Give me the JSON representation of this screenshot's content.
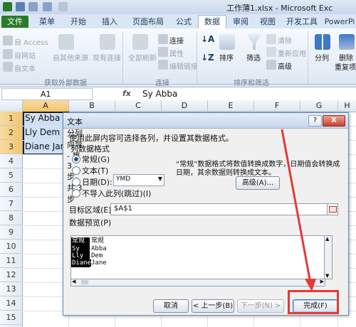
{
  "window": {
    "title": "工作薄1.xlsx - Microsoft Exc"
  },
  "ribbon": {
    "tabs": [
      "文件",
      "菜单",
      "开始",
      "插入",
      "页面布局",
      "公式",
      "数据",
      "审阅",
      "视图",
      "开发工具",
      "PowerPi"
    ],
    "active_tab": "数据",
    "external_group": {
      "items": [
        "自 Access",
        "自网站",
        "自文本",
        "自其他来源",
        "现有连接"
      ],
      "label": "获取外部数据"
    },
    "connections_group": {
      "items": [
        "全部刷新",
        "连接",
        "属性",
        "编辑链接"
      ],
      "label": "连接"
    },
    "sort_group": {
      "items": [
        "排序",
        "筛选",
        "清除",
        "重新应用",
        "高级"
      ],
      "label": "排序和筛选"
    },
    "data_tools": {
      "items": [
        "分列",
        "删除",
        "重复项"
      ]
    }
  },
  "formula_bar": {
    "name_box": "A1",
    "fx": "fx",
    "formula": "Sy Abba"
  },
  "sheet": {
    "columns": [
      "A",
      "B",
      "C",
      "D",
      "E",
      "F",
      "G",
      "H"
    ],
    "rows": [
      "1",
      "2",
      "3",
      "4",
      "5",
      "6",
      "7",
      "8",
      "9",
      "10",
      "11",
      "12",
      "13",
      "14",
      "15",
      "16"
    ],
    "cells": {
      "A1": "Sy Abba",
      "A2": "Lly Dem",
      "A3": "Diane Jan"
    }
  },
  "dialog": {
    "title": "文本分列向导 - 第 3 步，共 3 步",
    "help_label": "?",
    "close_label": "X",
    "instruction": "使用此屏内容可选择各列，并设置其数据格式。",
    "format_heading": "列数据格式",
    "formats": [
      "常规(G)",
      "文本(T)",
      "日期(D):",
      "不导入此列(跳过)(I)"
    ],
    "date_value": "YMD",
    "note_line1": "“常规”数据格式将数值转换成数字，日期值会转换成",
    "note_line2": "日期，其余数据则转换成文本。",
    "advanced_button": "高级(A)...",
    "destination_label": "目标区域(E):",
    "destination_value": "$A$1",
    "preview_label": "数据预览(P)",
    "preview_headers": [
      "常规",
      "常规"
    ],
    "preview_rows": [
      [
        "Sy",
        "Abba"
      ],
      [
        "Lly",
        "Dem"
      ],
      [
        "Diane",
        "Jane"
      ]
    ],
    "buttons": {
      "cancel": "取消",
      "back": "< 上一步(B)",
      "next": "下一步(N) >",
      "finish": "完成(F)"
    }
  },
  "annotation": {
    "color": "#e53935"
  }
}
